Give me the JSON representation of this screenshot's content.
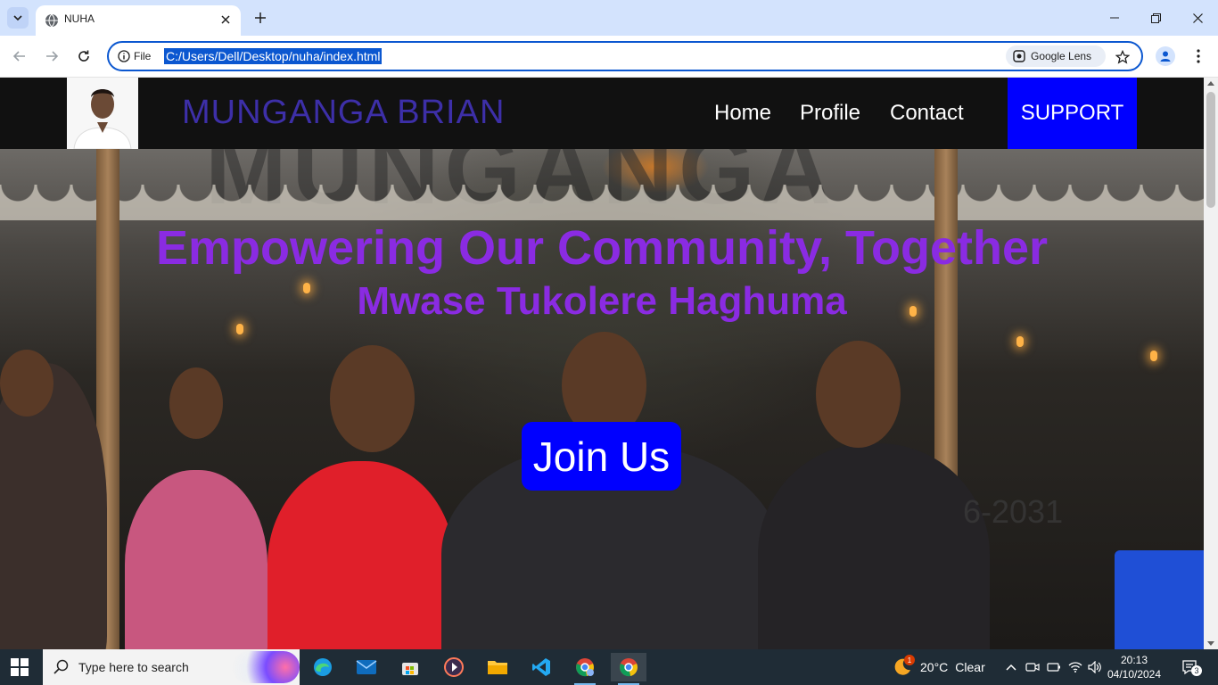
{
  "browser": {
    "tab_title": "NUHA",
    "scheme_label": "File",
    "url": "C:/Users/Dell/Desktop/nuha/index.html",
    "lens_label": "Google Lens"
  },
  "site": {
    "name": "MUNGANGA BRIAN",
    "nav": {
      "home": "Home",
      "profile": "Profile",
      "contact": "Contact",
      "support": "SUPPORT"
    },
    "hero": {
      "title": "Empowering Our Community, Together",
      "subtitle": "Mwase Tukolere Haghuma",
      "cta": "Join Us",
      "background_text": "MUNGANGA",
      "background_year": "6-2031"
    },
    "colors": {
      "header_bg": "#111111",
      "brand_name": "#3d2fa8",
      "accent_purple": "#8a2be2",
      "button_blue": "#0000ff"
    }
  },
  "taskbar": {
    "search_placeholder": "Type here to search",
    "weather_temp": "20°C",
    "weather_desc": "Clear",
    "weather_alert_count": "1",
    "time": "20:13",
    "date": "04/10/2024",
    "notification_count": "3",
    "apps": [
      "edge-icon",
      "mail-icon",
      "store-icon",
      "media-player-icon",
      "file-explorer-icon",
      "vscode-icon",
      "chrome-profile-icon",
      "chrome-icon"
    ]
  }
}
